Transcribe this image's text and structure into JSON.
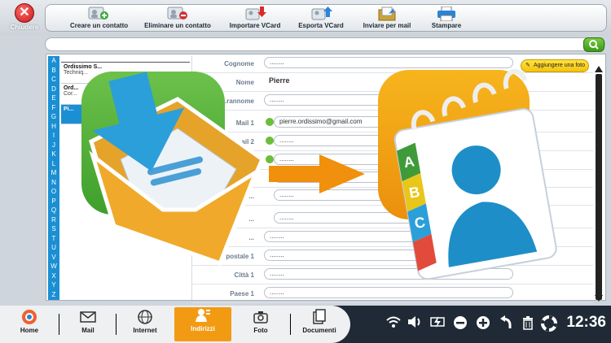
{
  "window": {
    "close_label": "Chiudere"
  },
  "toolbar": [
    {
      "name": "create-contact",
      "label": "Creare un contatto"
    },
    {
      "name": "delete-contact",
      "label": "Eliminare un contatto"
    },
    {
      "name": "import-vcard",
      "label": "Importare VCard"
    },
    {
      "name": "export-vcard",
      "label": "Esporta VCard"
    },
    {
      "name": "send-by-mail",
      "label": "Inviare per mail"
    },
    {
      "name": "print",
      "label": "Stampare"
    }
  ],
  "alphabet": [
    "A",
    "B",
    "C",
    "D",
    "E",
    "F",
    "G",
    "H",
    "I",
    "J",
    "K",
    "L",
    "M",
    "N",
    "O",
    "P",
    "Q",
    "R",
    "S",
    "T",
    "U",
    "V",
    "W",
    "X",
    "Y",
    "Z"
  ],
  "contacts": [
    {
      "name": "Ordissimo S...",
      "sub": "Techniq..."
    },
    {
      "name": "Ord...",
      "sub": "Cor..."
    },
    {
      "name": "Pi...",
      "sub": ""
    }
  ],
  "form": {
    "add_photo_label": "Aggiungere una foto",
    "fields": [
      {
        "label": "Cognome",
        "value": "........"
      },
      {
        "label": "Nome",
        "value": "Pierre"
      },
      {
        "label": "...rannome",
        "value": "........"
      },
      {
        "label": "Mail 1",
        "value": "pierre.ordissimo@gmail.com"
      },
      {
        "label": "...ail 2",
        "value": "........"
      },
      {
        "label": "...l 3",
        "value": "........"
      },
      {
        "label": "...",
        "value": "........"
      },
      {
        "label": "...",
        "value": "........"
      },
      {
        "label": "...",
        "value": "........"
      },
      {
        "label": "...",
        "value": "........"
      },
      {
        "label": "Codice postale 1",
        "value": "........"
      },
      {
        "label": "Città 1",
        "value": "........"
      },
      {
        "label": "Paese 1",
        "value": "........"
      }
    ]
  },
  "bottom_nav": [
    {
      "name": "home",
      "label": "Home"
    },
    {
      "name": "mail",
      "label": "Mail"
    },
    {
      "name": "internet",
      "label": "Internet"
    },
    {
      "name": "addresses",
      "label": "Indirizzi",
      "active": true
    },
    {
      "name": "photo",
      "label": "Foto"
    },
    {
      "name": "documents",
      "label": "Documenti"
    }
  ],
  "status": {
    "time": "12:36"
  },
  "icons": {
    "close": "close-icon",
    "wifi": "wifi-icon",
    "volume": "volume-icon",
    "power": "battery-charging-icon",
    "zoom_out": "zoom-out-icon",
    "zoom_in": "zoom-in-icon",
    "undo": "undo-icon",
    "trash": "trash-icon",
    "help": "lifebuoy-icon"
  },
  "colors": {
    "accent": "#1b8fd3",
    "active_tab": "#f29b12",
    "search_btn": "#4aa923",
    "orange_arrow": "#f0900c"
  }
}
